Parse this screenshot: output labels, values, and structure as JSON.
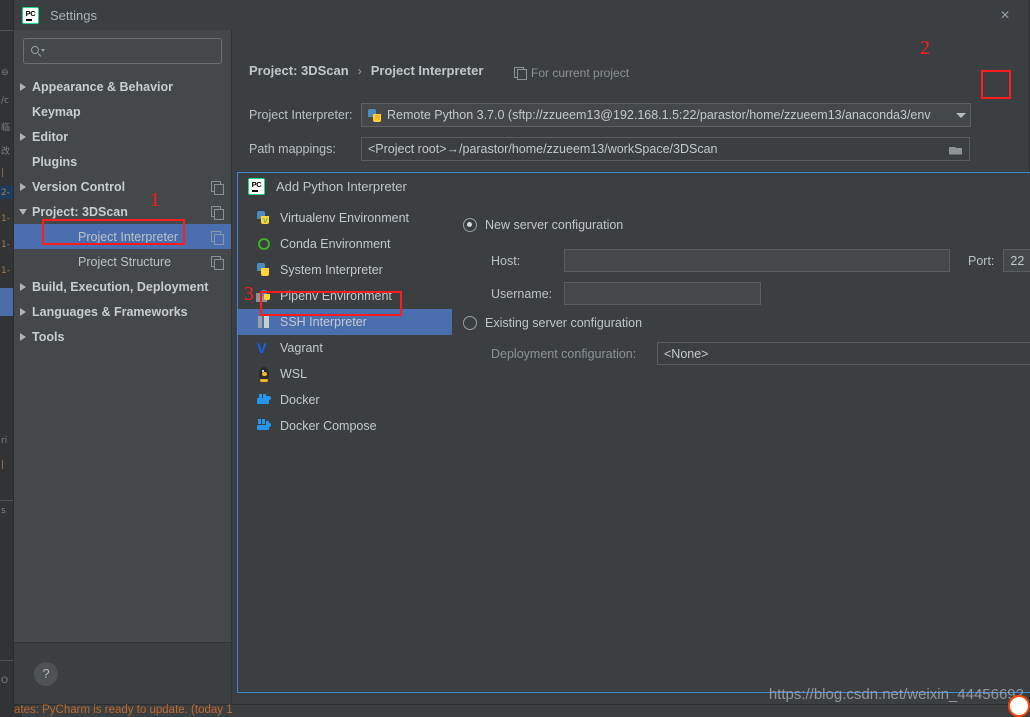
{
  "window": {
    "title": "Settings",
    "logo_text": "PC",
    "close_icon": "×"
  },
  "search": {
    "value": "",
    "placeholder": ""
  },
  "sidebar": {
    "items": [
      {
        "label": "Appearance & Behavior",
        "arrow": "right",
        "bold": true,
        "child": false,
        "copy": false,
        "selected": false
      },
      {
        "label": "Keymap",
        "arrow": "none",
        "bold": true,
        "child": false,
        "copy": false,
        "selected": false
      },
      {
        "label": "Editor",
        "arrow": "right",
        "bold": true,
        "child": false,
        "copy": false,
        "selected": false
      },
      {
        "label": "Plugins",
        "arrow": "none",
        "bold": true,
        "child": false,
        "copy": false,
        "selected": false
      },
      {
        "label": "Version Control",
        "arrow": "right",
        "bold": true,
        "child": false,
        "copy": true,
        "selected": false
      },
      {
        "label": "Project: 3DScan",
        "arrow": "down",
        "bold": true,
        "child": false,
        "copy": true,
        "selected": false
      },
      {
        "label": "Project Interpreter",
        "arrow": "none",
        "bold": false,
        "child": true,
        "copy": true,
        "selected": true
      },
      {
        "label": "Project Structure",
        "arrow": "none",
        "bold": false,
        "child": true,
        "copy": true,
        "selected": false
      },
      {
        "label": "Build, Execution, Deployment",
        "arrow": "right",
        "bold": true,
        "child": false,
        "copy": false,
        "selected": false
      },
      {
        "label": "Languages & Frameworks",
        "arrow": "right",
        "bold": true,
        "child": false,
        "copy": false,
        "selected": false
      },
      {
        "label": "Tools",
        "arrow": "right",
        "bold": true,
        "child": false,
        "copy": false,
        "selected": false
      }
    ],
    "help_label": "?"
  },
  "main": {
    "breadcrumb_parent": "Project: 3DScan",
    "breadcrumb_sep": "›",
    "breadcrumb_current": "Project Interpreter",
    "for_current_project": "For current project",
    "interpreter_label": "Project Interpreter:",
    "interpreter_value": "Remote Python 3.7.0 (sftp://zzueem13@192.168.1.5:22/parastor/home/zzueem13/anaconda3/env",
    "path_mappings_label": "Path mappings:",
    "path_mappings_value": "<Project root>→/parastor/home/zzueem13/workSpace/3DScan"
  },
  "subdialog": {
    "title": "Add Python Interpreter",
    "logo_text": "PC",
    "items": [
      {
        "label": "Virtualenv Environment",
        "icon": "python-venv-icon",
        "selected": false
      },
      {
        "label": "Conda Environment",
        "icon": "conda-icon",
        "selected": false
      },
      {
        "label": "System Interpreter",
        "icon": "python-icon",
        "selected": false
      },
      {
        "label": "Pipenv Environment",
        "icon": "pipenv-icon",
        "selected": false
      },
      {
        "label": "SSH Interpreter",
        "icon": "ssh-icon",
        "selected": true
      },
      {
        "label": "Vagrant",
        "icon": "vagrant-icon",
        "selected": false
      },
      {
        "label": "WSL",
        "icon": "wsl-icon",
        "selected": false
      },
      {
        "label": "Docker",
        "icon": "docker-icon",
        "selected": false
      },
      {
        "label": "Docker Compose",
        "icon": "docker-compose-icon",
        "selected": false
      }
    ],
    "new_server_label": "New server configuration",
    "host_label": "Host:",
    "host_value": "",
    "port_label": "Port:",
    "port_value": "22",
    "username_label": "Username:",
    "username_value": "",
    "existing_server_label": "Existing server configuration",
    "deployment_label": "Deployment configuration:",
    "deployment_value": "<None>"
  },
  "annotations": {
    "one": "1",
    "two": "2",
    "three": "3"
  },
  "watermark": {
    "url": "https://blog.csdn.net/weixin_44456692"
  },
  "statusbar": {
    "text": "ates: PyCharm is ready to update. (today 1"
  },
  "colors": {
    "accent_selection": "#4b6eaf",
    "annotation_red": "#ff1c1c",
    "dialog_bg": "#3c3f41",
    "sidebar_bg": "#45484a",
    "subdialog_border": "#3f86d6"
  }
}
